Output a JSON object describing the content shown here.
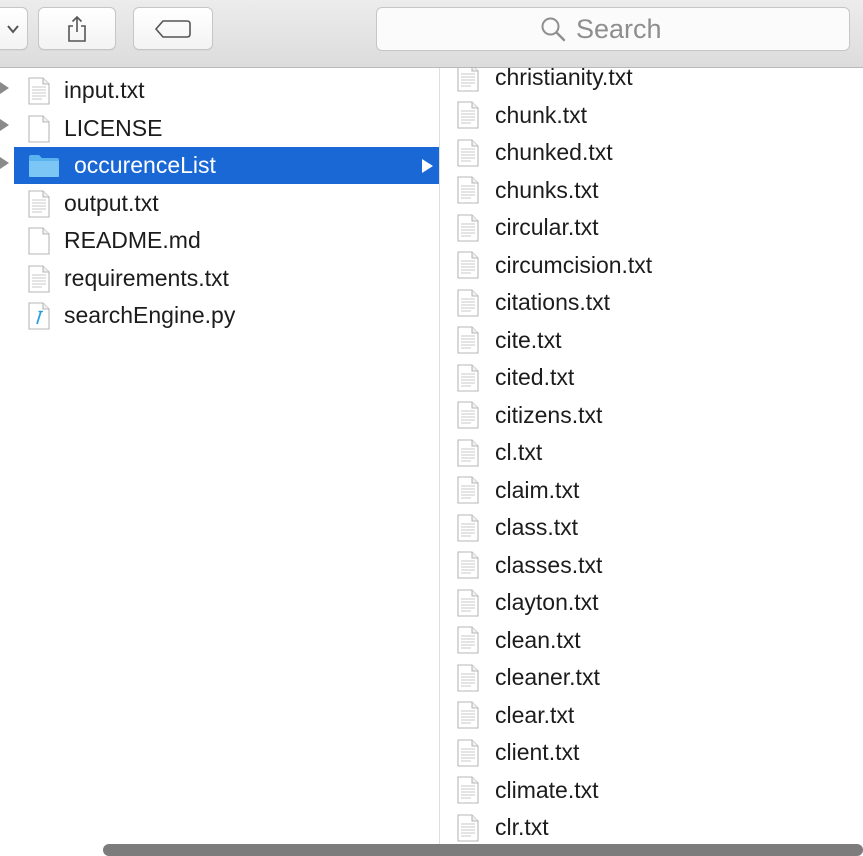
{
  "search": {
    "placeholder": "Search"
  },
  "column1": {
    "items": [
      {
        "name": "input.txt",
        "kind": "doc"
      },
      {
        "name": "LICENSE",
        "kind": "blank"
      },
      {
        "name": "occurenceList",
        "kind": "folder"
      },
      {
        "name": "output.txt",
        "kind": "doc"
      },
      {
        "name": "README.md",
        "kind": "blank"
      },
      {
        "name": "requirements.txt",
        "kind": "doc"
      },
      {
        "name": "searchEngine.py",
        "kind": "python"
      }
    ]
  },
  "column2": {
    "items": [
      "christianity.txt",
      "chunk.txt",
      "chunked.txt",
      "chunks.txt",
      "circular.txt",
      "circumcision.txt",
      "citations.txt",
      "cite.txt",
      "cited.txt",
      "citizens.txt",
      "cl.txt",
      "claim.txt",
      "class.txt",
      "classes.txt",
      "clayton.txt",
      "clean.txt",
      "cleaner.txt",
      "clear.txt",
      "client.txt",
      "climate.txt",
      "clr.txt"
    ]
  },
  "colors": {
    "selection": "#1a68d6",
    "folder": "#5ab2ee"
  }
}
